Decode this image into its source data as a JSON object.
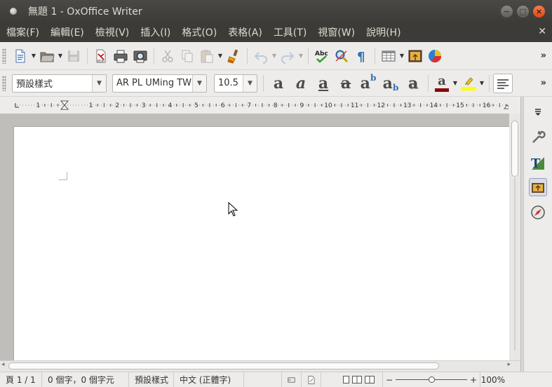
{
  "window": {
    "title": "無題 1 - OxOffice Writer"
  },
  "menu": {
    "items": [
      {
        "label": "檔案(F)"
      },
      {
        "label": "編輯(E)"
      },
      {
        "label": "檢視(V)"
      },
      {
        "label": "插入(I)"
      },
      {
        "label": "格式(O)"
      },
      {
        "label": "表格(A)"
      },
      {
        "label": "工具(T)"
      },
      {
        "label": "視窗(W)"
      },
      {
        "label": "說明(H)"
      }
    ]
  },
  "formatting": {
    "paragraph_style": "預設樣式",
    "font_name": "AR PL UMing TW",
    "font_size": "10.5",
    "font_color": "#8b0000",
    "highlight_color": "#ffff00"
  },
  "ruler": {
    "labels": [
      "1",
      "1",
      "2",
      "3",
      "4",
      "5",
      "6",
      "7",
      "8",
      "9",
      "10",
      "11",
      "12",
      "13",
      "14",
      "15",
      "16"
    ]
  },
  "statusbar": {
    "page": "頁 1 / 1",
    "word_count": "0 個字，0 個字元",
    "page_style": "預設樣式",
    "language": "中文 (正體字)",
    "zoom": "100%"
  }
}
